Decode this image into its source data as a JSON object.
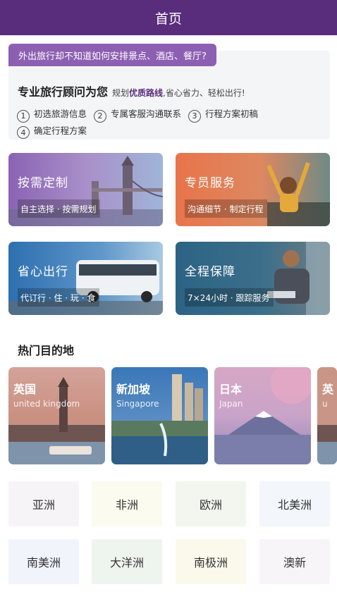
{
  "header": {
    "title": "首页"
  },
  "intro": {
    "tag": "外出旅行却不知道如何安排景点、酒店、餐厅?",
    "headline": "专业旅行顾问为您",
    "lead_pre": "规划",
    "lead_highlight": "优质路线",
    "lead_post": ",省心省力、轻松出行!",
    "steps": [
      {
        "num": "1",
        "label": "初选旅游信息"
      },
      {
        "num": "2",
        "label": "专属客服沟通联系"
      },
      {
        "num": "3",
        "label": "行程方案初稿"
      },
      {
        "num": "4",
        "label": "确定行程方案"
      }
    ]
  },
  "services": [
    {
      "title": "按需定制",
      "subtitle": "自主选择 · 按需规划"
    },
    {
      "title": "专员服务",
      "subtitle": "沟通细节 · 制定行程"
    },
    {
      "title": "省心出行",
      "subtitle": "代订行 · 住 · 玩 · 食"
    },
    {
      "title": "全程保障",
      "subtitle": "7×24小时 · 跟踪服务"
    }
  ],
  "destinations": {
    "title": "热门目的地",
    "items": [
      {
        "name": "英国",
        "en": "united kingdom"
      },
      {
        "name": "新加坡",
        "en": "Singapore"
      },
      {
        "name": "日本",
        "en": "Japan"
      },
      {
        "name": "英",
        "en": "u"
      }
    ]
  },
  "regions": [
    {
      "label": "亚洲",
      "color": "#f7f4f8"
    },
    {
      "label": "非洲",
      "color": "#fcfbef"
    },
    {
      "label": "欧洲",
      "color": "#f2f6ee"
    },
    {
      "label": "北美洲",
      "color": "#f3f6fb"
    },
    {
      "label": "南美洲",
      "color": "#f1f5fb"
    },
    {
      "label": "大洋洲",
      "color": "#eef5ee"
    },
    {
      "label": "南极洲",
      "color": "#fbf8ec"
    },
    {
      "label": "澳新",
      "color": "#f8f5f9"
    }
  ],
  "colors": {
    "brand": "#5a2d7c",
    "tag": "#8d5fb3"
  }
}
